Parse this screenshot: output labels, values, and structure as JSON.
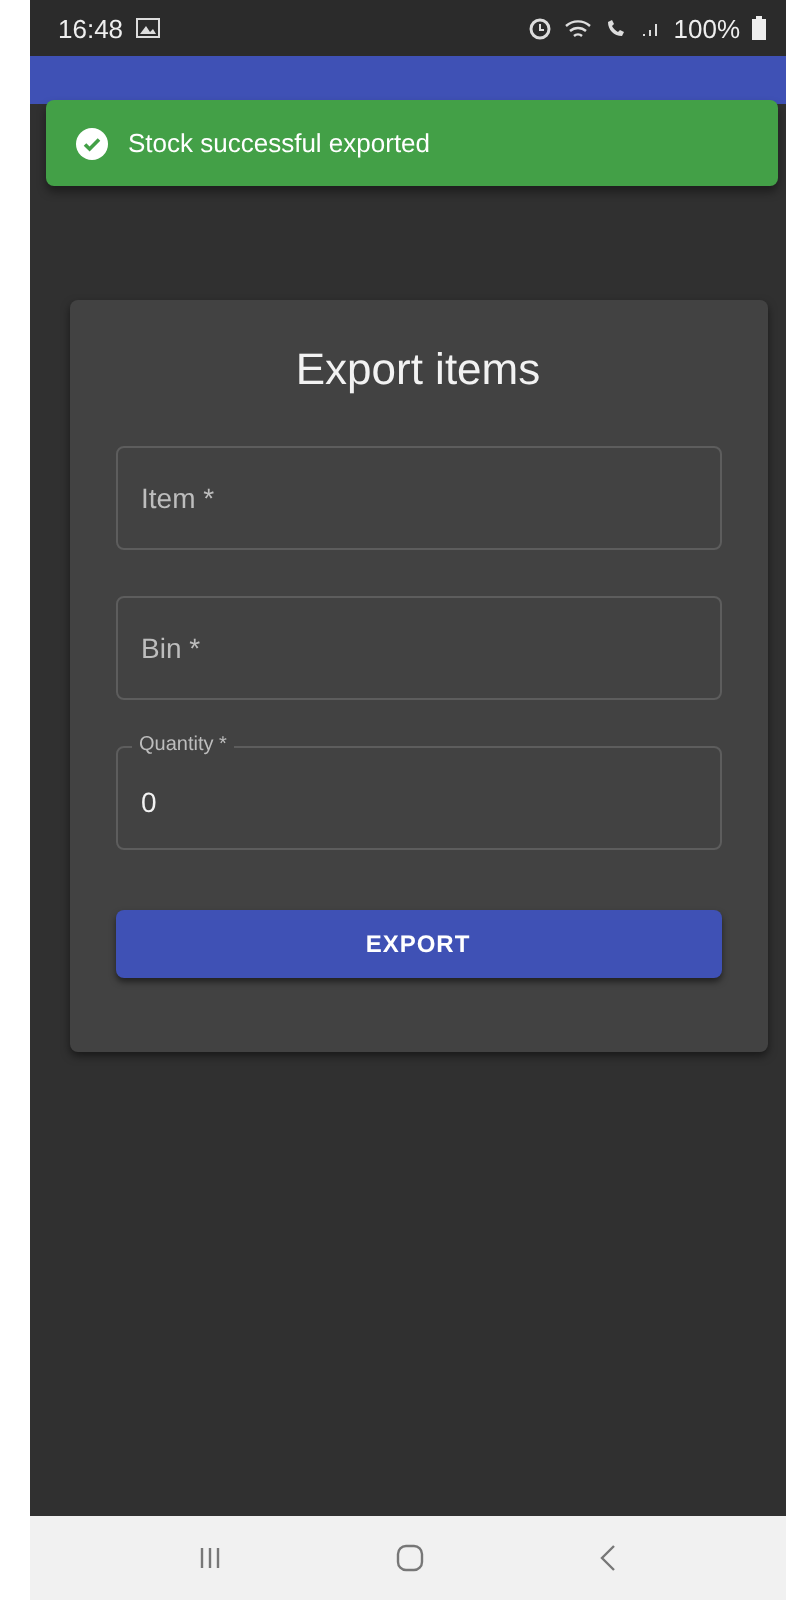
{
  "status_bar": {
    "time": "16:48",
    "battery": "100%"
  },
  "snackbar": {
    "message": "Stock successful exported",
    "kind": "success"
  },
  "form": {
    "title": "Export items",
    "fields": [
      {
        "label": "Item *"
      },
      {
        "label": "Bin *"
      },
      {
        "label": "Quantity *",
        "value": "0"
      }
    ],
    "button": "EXPORT"
  }
}
